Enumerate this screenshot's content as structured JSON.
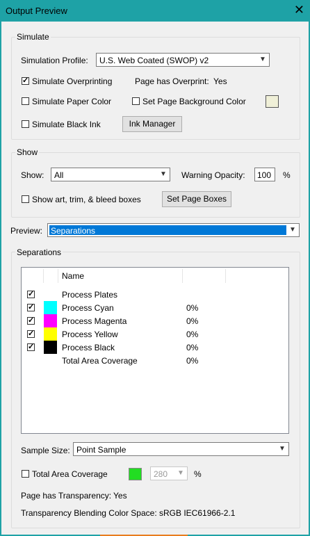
{
  "window": {
    "title": "Output Preview",
    "close": "✕"
  },
  "simulate": {
    "group_label": "Simulate",
    "profile_label": "Simulation Profile:",
    "profile_value": "U.S. Web Coated (SWOP) v2",
    "overprinting_label": "Simulate Overprinting",
    "overprinting_checked": true,
    "page_overprint_label": "Page has Overprint:",
    "page_overprint_value": "Yes",
    "paper_color_label": "Simulate Paper Color",
    "paper_color_checked": false,
    "bg_color_label": "Set Page Background Color",
    "bg_color_checked": false,
    "bg_swatch_color": "#f0f0d8",
    "black_ink_label": "Simulate Black Ink",
    "black_ink_checked": false,
    "ink_manager_label": "Ink Manager"
  },
  "show": {
    "group_label": "Show",
    "show_label": "Show:",
    "show_value": "All",
    "warning_label": "Warning Opacity:",
    "warning_value": "100",
    "warning_unit": "%",
    "boxes_label": "Show art, trim, & bleed boxes",
    "boxes_checked": false,
    "page_boxes_label": "Set Page Boxes"
  },
  "preview": {
    "label": "Preview:",
    "value": "Separations"
  },
  "separations": {
    "group_label": "Separations",
    "column_name": "Name",
    "rows": [
      {
        "checked": true,
        "color": "",
        "name": "Process Plates",
        "pct": ""
      },
      {
        "checked": true,
        "color": "#00ffff",
        "name": "Process Cyan",
        "pct": "0%"
      },
      {
        "checked": true,
        "color": "#ff00ff",
        "name": "Process Magenta",
        "pct": "0%"
      },
      {
        "checked": true,
        "color": "#ffff00",
        "name": "Process Yellow",
        "pct": "0%"
      },
      {
        "checked": true,
        "color": "#000000",
        "name": "Process Black",
        "pct": "0%"
      },
      {
        "checked": null,
        "color": "",
        "name": "Total Area Coverage",
        "pct": "0%"
      }
    ]
  },
  "sample": {
    "label": "Sample Size:",
    "value": "Point Sample"
  },
  "tac": {
    "label": "Total Area Coverage",
    "checked": false,
    "swatch_color": "#22dd22",
    "value": "280",
    "unit": "%"
  },
  "transparency": {
    "label": "Page has Transparency:",
    "value": "Yes",
    "space_label": "Transparency Blending Color Space:",
    "space_value": "sRGB IEC61966-2.1"
  }
}
